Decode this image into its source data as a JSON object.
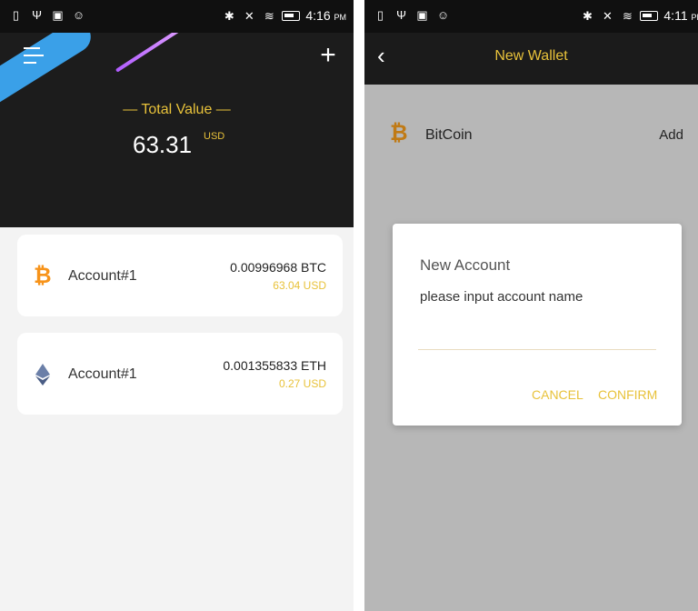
{
  "left": {
    "status_time": "4:16",
    "status_ampm": "PM",
    "total_label": "— Total Value —",
    "total_value": "63.31",
    "total_unit": "USD",
    "accounts": [
      {
        "name": "Account#1",
        "amount": "0.00996968 BTC",
        "usd": "63.04 USD",
        "icon": "bitcoin-icon"
      },
      {
        "name": "Account#1",
        "amount": "0.001355833 ETH",
        "usd": "0.27 USD",
        "icon": "ethereum-icon"
      }
    ]
  },
  "right": {
    "status_time": "4:11",
    "status_ampm": "PM",
    "title": "New Wallet",
    "coin_name": "BitCoin",
    "add_label": "Add",
    "dialog": {
      "title": "New Account",
      "message": "please input account name",
      "cancel": "CANCEL",
      "confirm": "CONFIRM"
    }
  },
  "colors": {
    "accent": "#e8c23a",
    "bitcoin": "#f7931a",
    "ethereum": "#5a6d95",
    "header": "#1c1c1c"
  }
}
